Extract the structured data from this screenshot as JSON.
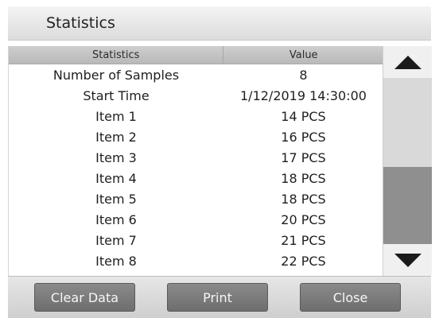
{
  "header": {
    "title": "Statistics"
  },
  "table": {
    "columns": [
      "Statistics",
      "Value"
    ],
    "rows": [
      {
        "label": "Number of Samples",
        "value": "8"
      },
      {
        "label": "Start Time",
        "value": "1/12/2019 14:30:00"
      },
      {
        "label": "Item 1",
        "value": "14 PCS"
      },
      {
        "label": "Item 2",
        "value": "16 PCS"
      },
      {
        "label": "Item 3",
        "value": "17 PCS"
      },
      {
        "label": "Item 4",
        "value": "18 PCS"
      },
      {
        "label": "Item 5",
        "value": "18 PCS"
      },
      {
        "label": "Item 6",
        "value": "20 PCS"
      },
      {
        "label": "Item 7",
        "value": "21 PCS"
      },
      {
        "label": "Item 8",
        "value": "22 PCS"
      }
    ]
  },
  "scrollbar": {
    "up_icon": "triangle-up-icon",
    "down_icon": "triangle-down-icon"
  },
  "footer": {
    "clear_label": "Clear Data",
    "print_label": "Print",
    "close_label": "Close"
  },
  "colors": {
    "button_bg": "#7d7d7d",
    "header_bg": "#bdbdbd",
    "scroll_thumb": "#8f8f8f"
  }
}
